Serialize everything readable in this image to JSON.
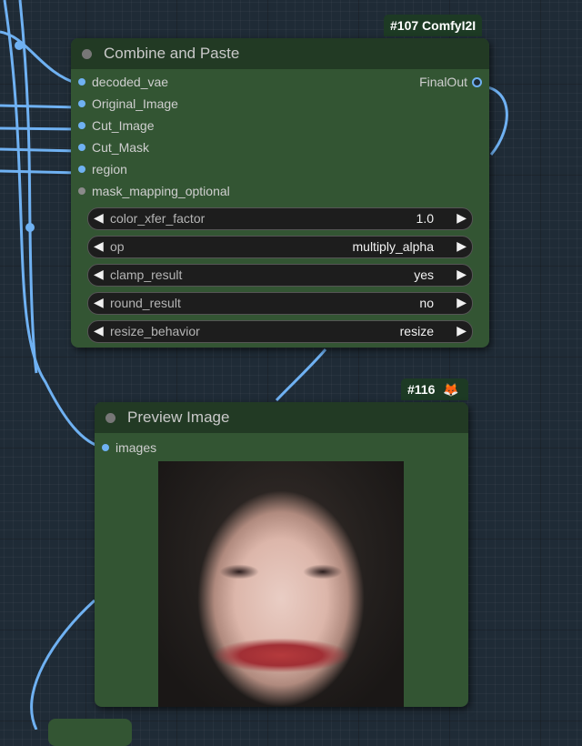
{
  "node_combine": {
    "badge": "#107 ComfyI2I",
    "title": "Combine and Paste",
    "inputs": [
      {
        "label": "decoded_vae",
        "optional": false
      },
      {
        "label": "Original_Image",
        "optional": false
      },
      {
        "label": "Cut_Image",
        "optional": false
      },
      {
        "label": "Cut_Mask",
        "optional": false
      },
      {
        "label": "region",
        "optional": false
      },
      {
        "label": "mask_mapping_optional",
        "optional": true
      }
    ],
    "output": "FinalOut",
    "widgets": [
      {
        "name": "color_xfer_factor",
        "value": "1.0"
      },
      {
        "name": "op",
        "value": "multiply_alpha"
      },
      {
        "name": "clamp_result",
        "value": "yes"
      },
      {
        "name": "round_result",
        "value": "no"
      },
      {
        "name": "resize_behavior",
        "value": "resize"
      }
    ]
  },
  "node_preview": {
    "badge": "#116",
    "badge_icon": "fox-icon",
    "title": "Preview Image",
    "input": "images"
  },
  "arrows": {
    "left": "◀",
    "right": "▶"
  },
  "colors": {
    "node_body": "#335533",
    "node_header": "#223a24",
    "wire": "#6fb1f2",
    "canvas": "#1f2b36"
  }
}
